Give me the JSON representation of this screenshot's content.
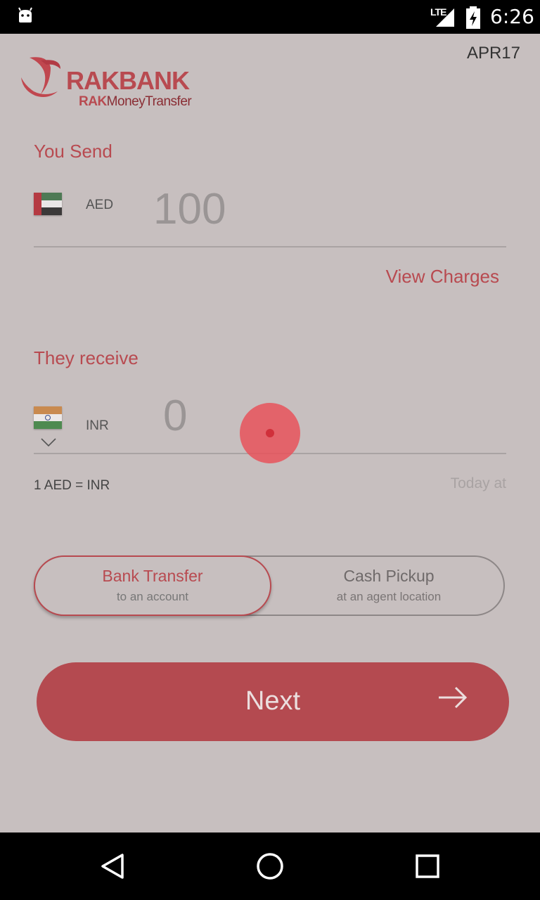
{
  "status_bar": {
    "network": "LTE",
    "time": "6:26"
  },
  "header": {
    "brand": "RAKBANK",
    "sub_brand_bold": "RAK",
    "sub_brand_rest": "MoneyTransfer",
    "build_label": "APR17"
  },
  "send": {
    "title": "You Send",
    "currency": "AED",
    "amount": "100",
    "flag": "uae-flag-icon"
  },
  "view_charges": "View Charges",
  "receive": {
    "title": "They receive",
    "currency": "INR",
    "amount": "0",
    "flag": "india-flag-icon"
  },
  "rate": {
    "text": "1 AED = INR",
    "updated": "Today at"
  },
  "transfer_options": [
    {
      "title": "Bank Transfer",
      "subtitle": "to an account",
      "selected": true
    },
    {
      "title": "Cash Pickup",
      "subtitle": "at an agent location",
      "selected": false
    }
  ],
  "next_button": {
    "label": "Next",
    "icon": "arrow-right-icon"
  },
  "colors": {
    "accent": "#b84a50",
    "background": "#c7bfbf",
    "button": "#b44a50"
  }
}
